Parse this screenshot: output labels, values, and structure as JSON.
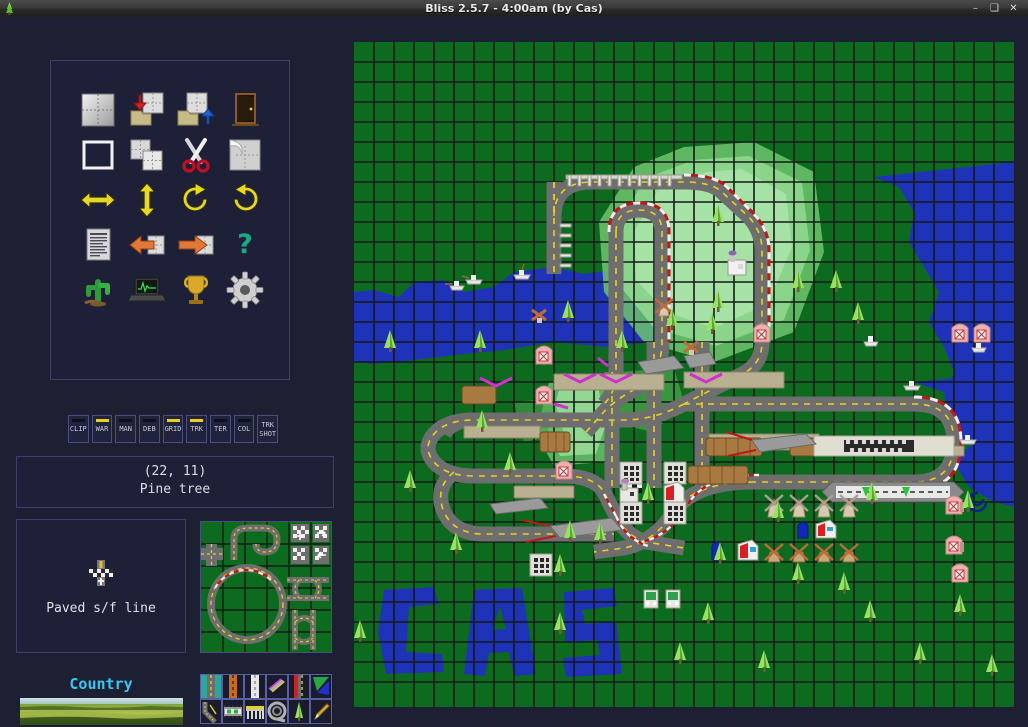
{
  "window": {
    "title": "Bliss 2.5.7 - 4:00am (by Cas)",
    "app_icon": "tree-icon",
    "minimize_label": "–",
    "maximize_label": "❑",
    "close_label": "✕",
    "bg_color": "#1d1f33",
    "panel_border_color": "#3b4070"
  },
  "toolbar": {
    "tools": [
      {
        "name": "new-map",
        "label": "New map"
      },
      {
        "name": "open-map",
        "label": "Open map"
      },
      {
        "name": "save-map",
        "label": "Save map"
      },
      {
        "name": "exit-door",
        "label": "Exit"
      },
      {
        "name": "select-rect",
        "label": "Select"
      },
      {
        "name": "copy-tiles",
        "label": "Copy"
      },
      {
        "name": "cut-scissors",
        "label": "Cut"
      },
      {
        "name": "paste-page",
        "label": "Paste"
      },
      {
        "name": "flip-horizontal",
        "label": "Flip horizontal"
      },
      {
        "name": "flip-vertical",
        "label": "Flip vertical"
      },
      {
        "name": "rotate-clockwise",
        "label": "Rotate clockwise"
      },
      {
        "name": "undo-arrow",
        "label": "Undo"
      },
      {
        "name": "map-properties",
        "label": "Map properties"
      },
      {
        "name": "import-left",
        "label": "Import"
      },
      {
        "name": "export-right",
        "label": "Export"
      },
      {
        "name": "help-question",
        "label": "Help"
      },
      {
        "name": "scenery-cactus",
        "label": "Scenery"
      },
      {
        "name": "laptop-monitor",
        "label": "Test / preview"
      },
      {
        "name": "trophy",
        "label": "Championship"
      },
      {
        "name": "settings-gear",
        "label": "Settings"
      }
    ]
  },
  "toggles": [
    {
      "name": "clip",
      "label": "CLIP",
      "active": false
    },
    {
      "name": "war",
      "label": "WAR",
      "active": true
    },
    {
      "name": "man",
      "label": "MAN",
      "active": false
    },
    {
      "name": "deb",
      "label": "DEB",
      "active": false
    },
    {
      "name": "grid",
      "label": "GRID",
      "active": true
    },
    {
      "name": "trk",
      "label": "TRK",
      "active": true
    },
    {
      "name": "ter",
      "label": "TER",
      "active": false
    },
    {
      "name": "col",
      "label": "COL",
      "active": false
    },
    {
      "name": "trkshot",
      "label": "TRK SHOT",
      "label_line1": "TRK",
      "label_line2": "SHOT",
      "active": false
    }
  ],
  "status": {
    "coordinates": "(22, 11)",
    "tile_name": "Pine tree"
  },
  "preview": {
    "icon": "start-finish-line-icon",
    "label": "Paved s/f line"
  },
  "theme": {
    "name": "Country",
    "label_color": "#35c8f0"
  },
  "categories": [
    {
      "name": "road-paved",
      "label": "Paved road"
    },
    {
      "name": "road-dirt",
      "label": "Dirt road"
    },
    {
      "name": "road-white-line",
      "label": "White line road"
    },
    {
      "name": "bridge-ramp",
      "label": "Bridge / ramp"
    },
    {
      "name": "kerb-stripe",
      "label": "Kerb"
    },
    {
      "name": "terrain-hill",
      "label": "Terrain"
    },
    {
      "name": "road-junction",
      "label": "Junction"
    },
    {
      "name": "pit-lane",
      "label": "Pit lane"
    },
    {
      "name": "grandstand",
      "label": "Grandstand"
    },
    {
      "name": "tunnel-loop",
      "label": "Tunnel"
    },
    {
      "name": "pine-tree",
      "label": "Pine tree"
    },
    {
      "name": "pencil-tool",
      "label": "Pencil"
    }
  ],
  "map": {
    "grid_size": 20,
    "cols": 33,
    "rows": 33,
    "colors": {
      "grass": "#0d6b1f",
      "grass_dark": "#0a5418",
      "grid_line": "#141a16",
      "water": "#1f33b8",
      "hill_light": "#7fcf7f",
      "hill_mid": "#55b055",
      "road": "#6e6e6e",
      "road_edge": "#4a4a4a",
      "road_dash": "#e8d020",
      "kerb_red": "#c01818",
      "kerb_white": "#e8e8e8",
      "bridge": "#b8b090",
      "tunnel": "#9a7a4a",
      "tree": "#9ae063",
      "building": "#dcdcd0"
    },
    "water_letters": "CAS",
    "cursor_position": "(22, 11)"
  }
}
